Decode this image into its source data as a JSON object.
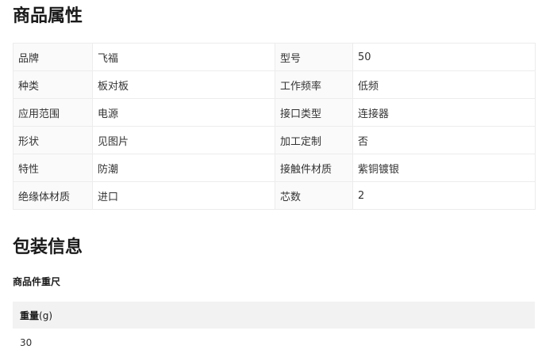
{
  "attributes_section": {
    "title": "商品属性",
    "rows": [
      [
        {
          "key": "品牌",
          "value": "飞福"
        },
        {
          "key": "型号",
          "value": "50"
        }
      ],
      [
        {
          "key": "种类",
          "value": "板对板"
        },
        {
          "key": "工作频率",
          "value": "低频"
        }
      ],
      [
        {
          "key": "应用范围",
          "value": "电源"
        },
        {
          "key": "接口类型",
          "value": "连接器"
        }
      ],
      [
        {
          "key": "形状",
          "value": "见图片"
        },
        {
          "key": "加工定制",
          "value": "否"
        }
      ],
      [
        {
          "key": "特性",
          "value": "防潮"
        },
        {
          "key": "接触件材质",
          "value": "紫铜镀银"
        }
      ],
      [
        {
          "key": "绝缘体材质",
          "value": "进口"
        },
        {
          "key": "芯数",
          "value": "2"
        }
      ]
    ]
  },
  "packaging_section": {
    "title": "包装信息",
    "subtitle": "商品件重尺",
    "weight_header_bold": "重量",
    "weight_header_unit": "(g)",
    "weight_value": "30"
  }
}
